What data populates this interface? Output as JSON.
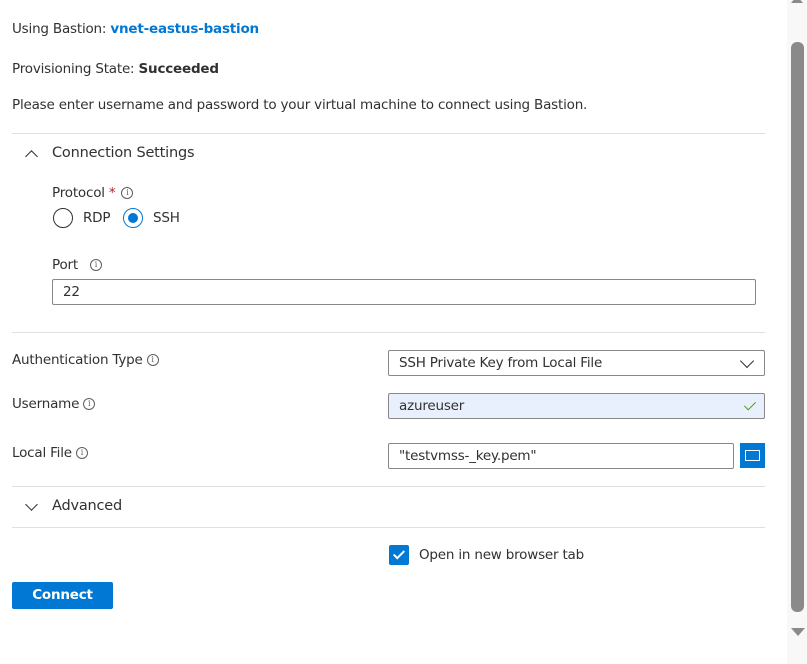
{
  "bastion": {
    "label": "Using Bastion:",
    "name": "vnet-eastus-bastion"
  },
  "provisioning": {
    "label": "Provisioning State:",
    "value": "Succeeded"
  },
  "instructions": "Please enter username and password to your virtual machine to connect using Bastion.",
  "connection_settings": {
    "title": "Connection Settings",
    "expanded": true,
    "protocol": {
      "label": "Protocol",
      "required": "*",
      "options": [
        "RDP",
        "SSH"
      ],
      "selected": "SSH"
    },
    "port": {
      "label": "Port",
      "value": "22"
    }
  },
  "auth_type": {
    "label": "Authentication Type",
    "value": "SSH Private Key from Local File"
  },
  "username": {
    "label": "Username",
    "value": "azureuser"
  },
  "local_file": {
    "label": "Local File",
    "value": "\"testvmss-_key.pem\""
  },
  "advanced": {
    "title": "Advanced",
    "expanded": false
  },
  "open_new_tab": {
    "label": "Open in new browser tab",
    "checked": true
  },
  "connect_label": "Connect",
  "colors": {
    "accent": "#0078d4",
    "success": "#57a300"
  }
}
